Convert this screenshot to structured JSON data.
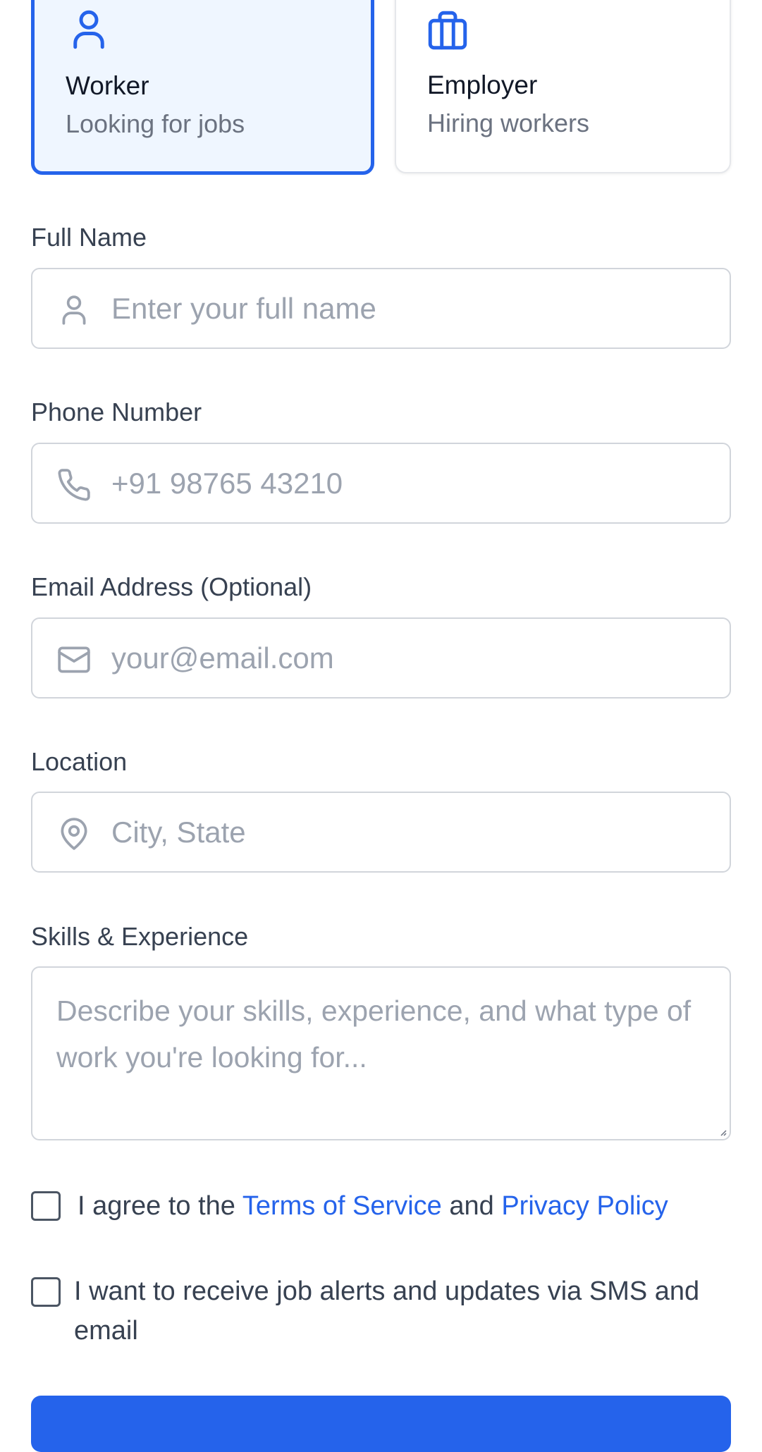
{
  "roles": {
    "worker": {
      "title": "Worker",
      "subtitle": "Looking for jobs",
      "selected": true
    },
    "employer": {
      "title": "Employer",
      "subtitle": "Hiring workers",
      "selected": false
    }
  },
  "fields": {
    "full_name": {
      "label": "Full Name",
      "placeholder": "Enter your full name",
      "icon": "user-icon"
    },
    "phone": {
      "label": "Phone Number",
      "placeholder": "+91 98765 43210",
      "icon": "phone-icon"
    },
    "email": {
      "label": "Email Address (Optional)",
      "placeholder": "your@email.com",
      "icon": "mail-icon"
    },
    "location": {
      "label": "Location",
      "placeholder": "City, State",
      "icon": "map-pin-icon"
    },
    "skills": {
      "label": "Skills & Experience",
      "placeholder": "Describe your skills, experience, and what type of work you're looking for..."
    }
  },
  "agreements": {
    "terms": {
      "prefix": "I agree to the",
      "terms_link": "Terms of Service",
      "and": "and",
      "privacy_link": "Privacy Policy",
      "checked": false
    },
    "alerts": {
      "text": "I want to receive job alerts and updates via SMS and email",
      "checked": false
    }
  },
  "colors": {
    "accent": "#2563eb",
    "selected_bg": "#eff6ff",
    "border": "#d1d5db",
    "placeholder": "#9ca3af"
  }
}
